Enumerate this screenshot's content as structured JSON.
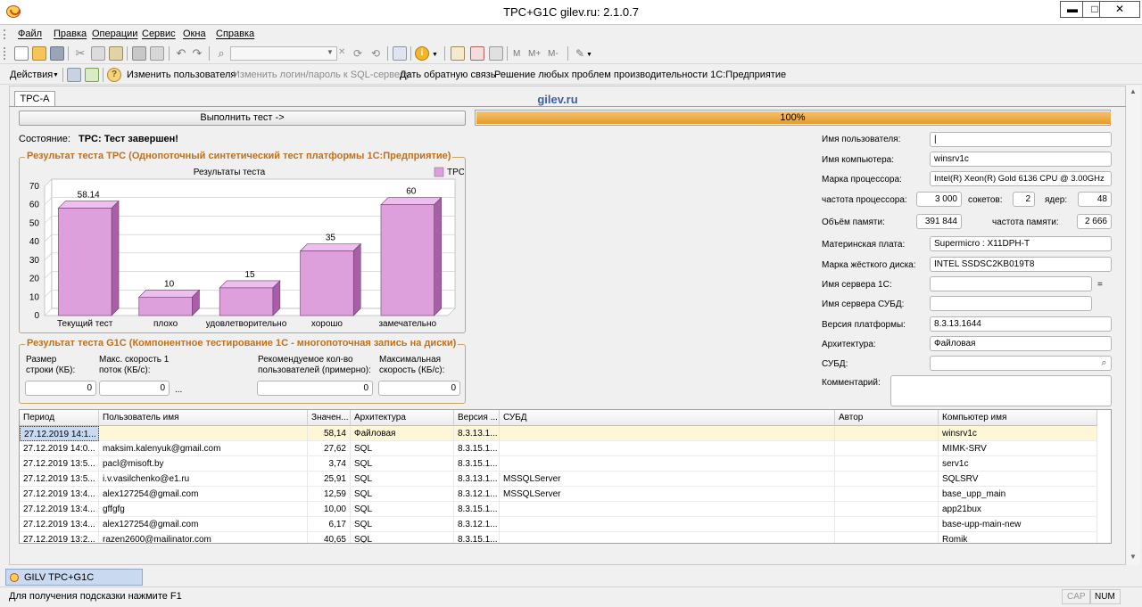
{
  "window": {
    "title": "TPC+G1C gilev.ru: 2.1.0.7",
    "min": "▬",
    "max": "□",
    "close": "✕"
  },
  "menu": [
    "Файл",
    "Правка",
    "Операции",
    "Сервис",
    "Окна",
    "Справка"
  ],
  "actions": {
    "actions_label": "Действия",
    "change_user": "Изменить пользователя",
    "change_login": "Изменить логин/пароль к SQL-серверу",
    "feedback": "Дать обратную связь",
    "solve": "Решение любых проблем производительности 1С:Предприятие"
  },
  "toolbar": {
    "memory_buttons": [
      "M",
      "M+",
      "M-"
    ]
  },
  "tab": {
    "label": "TPC-A",
    "brand": "gilev.ru"
  },
  "run_button": "Выполнить тест ->",
  "progress": {
    "value": 100,
    "text": "100%"
  },
  "state": {
    "label": "Состояние:",
    "value": "TPC: Тест завершен!"
  },
  "tpc_group": {
    "title": "Результат теста TPC (Однопоточный синтетический тест платформы 1С:Предприятие)"
  },
  "chart_data": {
    "type": "bar",
    "title": "Результаты теста",
    "categories": [
      "Текущий тест",
      "плохо",
      "удовлетворительно",
      "хорошо",
      "замечательно"
    ],
    "series": [
      {
        "name": "TPC-A-local Throughput",
        "values": [
          58.14,
          10,
          15,
          35,
          60
        ]
      }
    ],
    "value_labels": [
      "58.14",
      "10",
      "15",
      "35",
      "60"
    ],
    "ylim": [
      0,
      70
    ],
    "yticks": [
      "0",
      "10",
      "20",
      "30",
      "40",
      "50",
      "60",
      "70"
    ],
    "legend": "top-right",
    "color": "#dda0dd"
  },
  "g1c_group": {
    "title": "Результат теста G1C (Компонентное тестирование 1С - многопоточная запись на диски)",
    "row_size_label": "Размер строки (КБ):",
    "max_speed_label": "Макс. скорость 1 поток (КБ/с):",
    "rec_users_label": "Рекомендуемое кол-во пользователей (примерно):",
    "max_speed2_label": "Максимальная скорость (КБ/с):",
    "row_size": "0",
    "max_speed": "0",
    "ellipsis": "...",
    "rec_users": "0",
    "max_speed2": "0"
  },
  "info": {
    "user_label": "Имя пользователя:",
    "user": "|",
    "computer_label": "Имя компьютера:",
    "computer": "winsrv1c",
    "cpu_label": "Марка процессора:",
    "cpu": "Intel(R) Xeon(R) Gold 6136 CPU @ 3.00GHz",
    "freq_label": "частота процессора:",
    "freq": "3 000",
    "sockets_label": "сокетов:",
    "sockets": "2",
    "cores_label": "ядер:",
    "cores": "48",
    "mem_label": "Объём памяти:",
    "mem": "391 844",
    "memfreq_label": "частота памяти:",
    "memfreq": "2 666",
    "board_label": "Материнская плата:",
    "board": "Supermicro : X11DPH-T",
    "disk_label": "Марка жёсткого диска:",
    "disk": "INTEL SSDSC2KB019T8",
    "server1c_label": "Имя сервера 1С:",
    "server1c": "",
    "eq": "=",
    "dbserver_label": "Имя сервера СУБД:",
    "dbserver": "",
    "platform_label": "Версия платформы:",
    "platform": "8.3.13.1644",
    "arch_label": "Архитектура:",
    "arch": "Файловая",
    "dbms_label": "СУБД:",
    "dbms": "",
    "comment_label": "Комментарий:",
    "comment": ""
  },
  "grid": {
    "headers": [
      "Период",
      "Пользователь имя",
      "Значен...",
      "Архитектура",
      "Версия ...",
      "СУБД",
      "Автор",
      "Компьютер имя"
    ],
    "rows": [
      [
        "27.12.2019 14:1...",
        "",
        "58,14",
        "Файловая",
        "8.3.13.1...",
        "",
        "",
        "winsrv1c"
      ],
      [
        "27.12.2019 14:0...",
        "maksim.kalenyuk@gmail.com",
        "27,62",
        "SQL",
        "8.3.15.1...",
        "",
        "",
        "MIMK-SRV"
      ],
      [
        "27.12.2019 13:5...",
        "pacl@misoft.by",
        "3,74",
        "SQL",
        "8.3.15.1...",
        "",
        "",
        "serv1c"
      ],
      [
        "27.12.2019 13:5...",
        "i.v.vasilchenko@e1.ru",
        "25,91",
        "SQL",
        "8.3.13.1...",
        "MSSQLServer",
        "",
        "SQLSRV"
      ],
      [
        "27.12.2019 13:4...",
        "alex127254@gmail.com",
        "12,59",
        "SQL",
        "8.3.12.1...",
        "MSSQLServer",
        "",
        "base_upp_main"
      ],
      [
        "27.12.2019 13:4...",
        "gffgfg",
        "10,00",
        "SQL",
        "8.3.15.1...",
        "",
        "",
        "app21bux"
      ],
      [
        "27.12.2019 13:4...",
        "alex127254@gmail.com",
        "6,17",
        "SQL",
        "8.3.12.1...",
        "",
        "",
        "base-upp-main-new"
      ],
      [
        "27.12.2019 13:2...",
        "razen2600@mailinator.com",
        "40,65",
        "SQL",
        "8.3.15.1...",
        "",
        "",
        "Romik"
      ]
    ]
  },
  "taskbar": {
    "label": "GILV TPC+G1C"
  },
  "status": {
    "hint": "Для получения подсказки нажмите F1",
    "cap": "CAP",
    "num": "NUM"
  },
  "colors": {
    "bar": "#dda0dd",
    "bar_side": "#a85fa8",
    "bar_top": "#eebfee",
    "group_title": "#c2701a",
    "progress": "#e49b2c",
    "brand": "#3b5fa8"
  }
}
